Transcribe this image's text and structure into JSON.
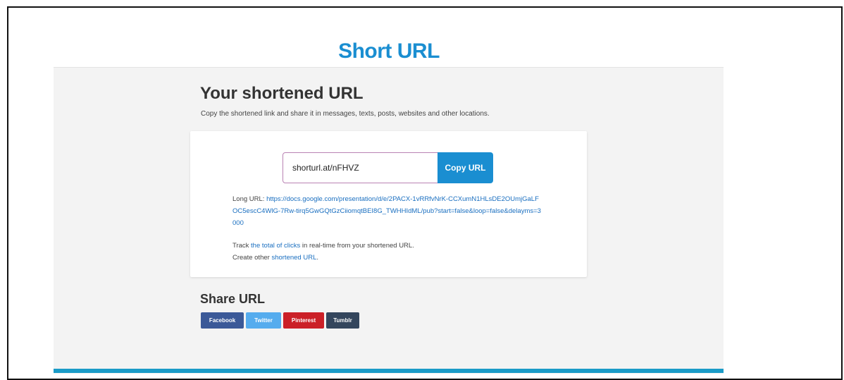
{
  "site": {
    "title": "Short URL"
  },
  "result": {
    "heading": "Your shortened URL",
    "description": "Copy the shortened link and share it in messages, texts, posts, websites and other locations.",
    "short_url": "shorturl.at/nFHVZ",
    "copy_label": "Copy URL",
    "long_url_label": "Long URL:",
    "long_url": "https://docs.google.com/presentation/d/e/2PACX-1vRRfvNrK-CCXumN1HLsDE2OUmjGaLFOC5escC4WlG-7Rw-tirq5GwGQtGzCiiomqtBEI8G_TWHHIdML/pub?start=false&loop=false&delayms=3000",
    "track_prefix": "Track",
    "track_link": "the total of clicks",
    "track_suffix": "in real-time from your shortened URL.",
    "create_prefix": "Create other",
    "create_link": "shortened URL",
    "create_suffix": "."
  },
  "share": {
    "heading": "Share URL",
    "buttons": {
      "facebook": "Facebook",
      "twitter": "Twitter",
      "pinterest": "Pinterest",
      "tumblr": "Tumblr"
    }
  },
  "colors": {
    "brand": "#1a8ed1",
    "facebook": "#3b5998",
    "twitter": "#55acee",
    "pinterest": "#cb2027",
    "tumblr": "#34465d",
    "footer_bar": "#1a9bc7"
  }
}
